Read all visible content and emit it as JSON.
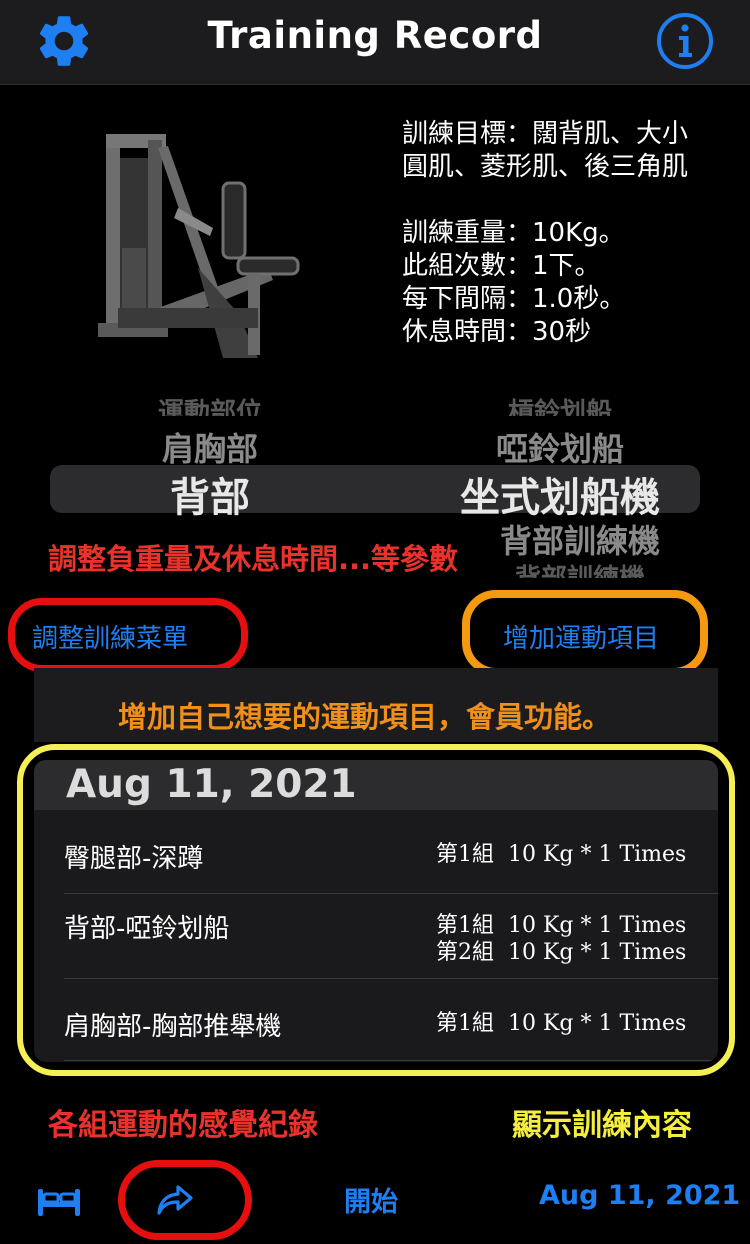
{
  "header": {
    "title": "Training Record",
    "settings_icon": "gear-icon",
    "info_icon": "info-icon"
  },
  "machine_image": "seated-row-machine",
  "exercise_info": {
    "target": "訓練目標：闊背肌、大小圓肌、菱形肌、後三角肌",
    "weight": "訓練重量：10Kg。",
    "reps": "此組次數：1下。",
    "interval": "每下間隔：1.0秒。",
    "rest": "休息時間：30秒"
  },
  "picker": {
    "left": {
      "above2": "運動部位",
      "above1": "肩胸部",
      "selected": "背部"
    },
    "right": {
      "above2": "槓鈴划船",
      "above1": "啞鈴划船",
      "selected": "坐式划船機",
      "below1": "背部訓練機",
      "below2": "背部訓練機"
    }
  },
  "annotations": {
    "adjust_params": "調整負重量及休息時間...等參數",
    "add_custom": "增加自己想要的運動項目，會員功能。",
    "feeling_log": "各組運動的感覺紀錄",
    "show_content": "顯示訓練內容"
  },
  "actions": {
    "adjust_menu": "調整訓練菜單",
    "add_exercise": "增加運動項目"
  },
  "record": {
    "date": "Aug 11, 2021",
    "rows": [
      {
        "title": "臀腿部-深蹲",
        "sets": "第1組  10 Kg * 1 Times"
      },
      {
        "title": "背部-啞鈴划船",
        "sets": "第1組  10 Kg * 1 Times\n第2組  10 Kg * 1 Times"
      },
      {
        "title": "肩胸部-胸部推舉機",
        "sets": "第1組  10 Kg * 1 Times"
      }
    ]
  },
  "bottom_bar": {
    "bed_icon": "bed-icon",
    "share_icon": "share-arrow-icon",
    "start_label": "開始",
    "date_label": "Aug 11, 2021"
  },
  "colors": {
    "accent": "#1e7ff2",
    "annotation_red": "#e8322b",
    "annotation_orange": "#f0901a",
    "annotation_yellow": "#f5ee3c"
  }
}
